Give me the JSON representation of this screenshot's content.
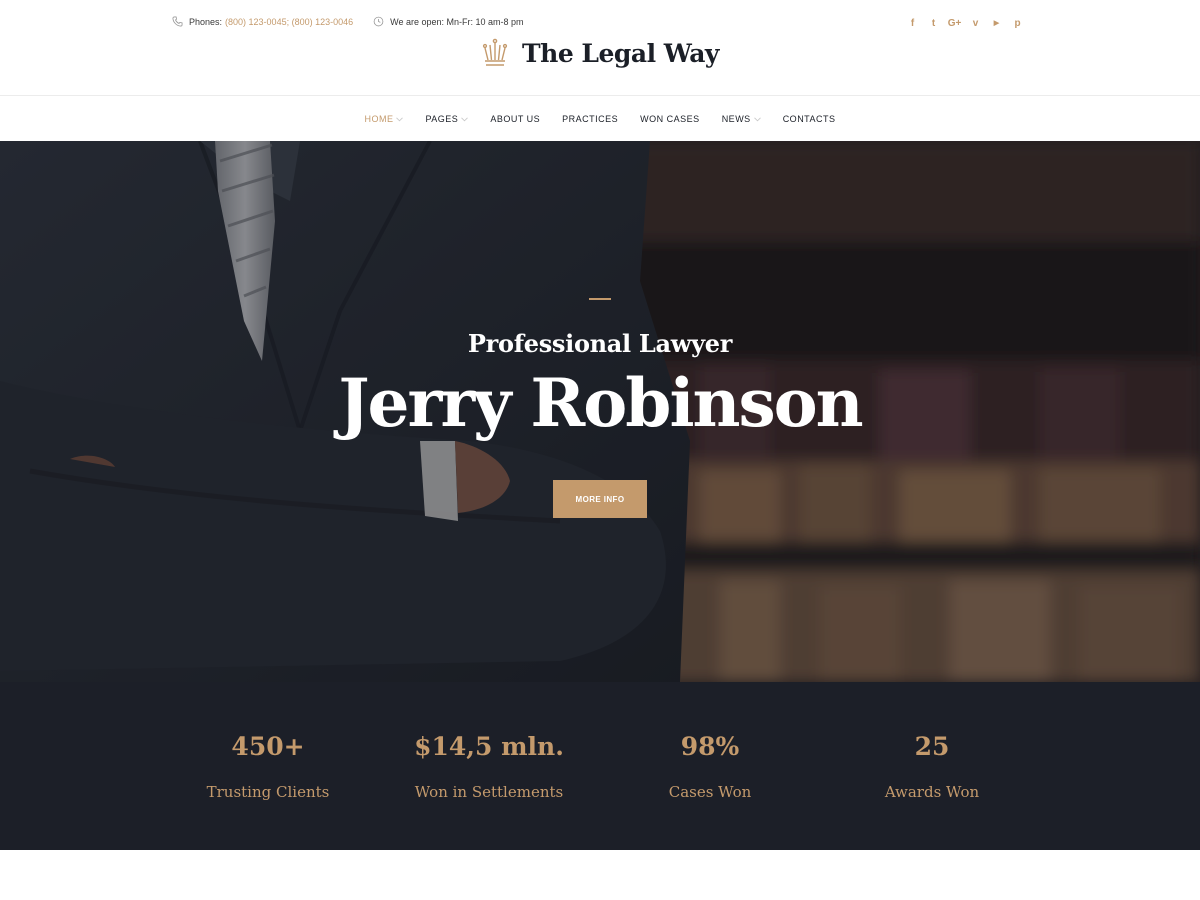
{
  "topbar": {
    "phones_label": "Phones:",
    "phones_value": "(800) 123-0045; (800) 123-0046",
    "hours_label": "We are open: Mn-Fr: 10 am-8 pm",
    "social": [
      {
        "icon": "facebook-icon",
        "glyph": "f"
      },
      {
        "icon": "twitter-icon",
        "glyph": "t"
      },
      {
        "icon": "google-plus-icon",
        "glyph": "G+"
      },
      {
        "icon": "vimeo-icon",
        "glyph": "v"
      },
      {
        "icon": "youtube-icon",
        "glyph": "▶"
      },
      {
        "icon": "pinterest-icon",
        "glyph": "p"
      }
    ]
  },
  "logo": {
    "text": "The Legal Way",
    "icon": "crown-icon"
  },
  "nav": {
    "items": [
      {
        "label": "HOME",
        "active": true,
        "dropdown": true
      },
      {
        "label": "PAGES",
        "active": false,
        "dropdown": true
      },
      {
        "label": "ABOUT US",
        "active": false,
        "dropdown": false
      },
      {
        "label": "PRACTICES",
        "active": false,
        "dropdown": false
      },
      {
        "label": "WON CASES",
        "active": false,
        "dropdown": false
      },
      {
        "label": "NEWS",
        "active": false,
        "dropdown": true
      },
      {
        "label": "CONTACTS",
        "active": false,
        "dropdown": false
      }
    ]
  },
  "hero": {
    "subtitle": "Professional Lawyer",
    "title": "Jerry Robinson",
    "button_label": "MORE INFO"
  },
  "stats": [
    {
      "value": "450+",
      "label": "Trusting Clients"
    },
    {
      "value": "$14,5 mln.",
      "label": "Won in Settlements"
    },
    {
      "value": "98%",
      "label": "Cases Won"
    },
    {
      "value": "25",
      "label": "Awards Won"
    }
  ],
  "colors": {
    "accent": "#c49a6c",
    "dark": "#1c1f28",
    "text": "#1b1f27"
  }
}
